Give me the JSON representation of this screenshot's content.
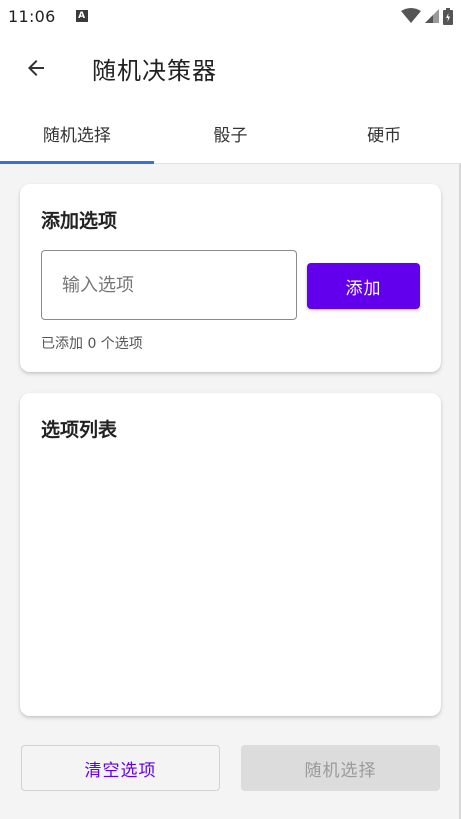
{
  "status_bar": {
    "time": "11:06",
    "notification_badge": "A",
    "icons": [
      "wifi-icon",
      "cell-signal-icon",
      "battery-icon"
    ]
  },
  "app_bar": {
    "title": "随机决策器",
    "back_icon": "arrow-left-icon"
  },
  "tabs": [
    {
      "label": "随机选择",
      "active": true
    },
    {
      "label": "骰子",
      "active": false
    },
    {
      "label": "硬币",
      "active": false
    }
  ],
  "add_card": {
    "title": "添加选项",
    "input_placeholder": "输入选项",
    "input_value": "",
    "add_button_label": "添加",
    "added_count_text": "已添加 0 个选项"
  },
  "list_card": {
    "title": "选项列表",
    "items": []
  },
  "actions": {
    "clear_label": "清空选项",
    "random_label": "随机选择",
    "random_enabled": false
  },
  "colors": {
    "accent": "#6200ee",
    "tab_indicator": "#3b6fd8",
    "background": "#f4f4f4",
    "disabled_button": "#dcdcdc"
  }
}
